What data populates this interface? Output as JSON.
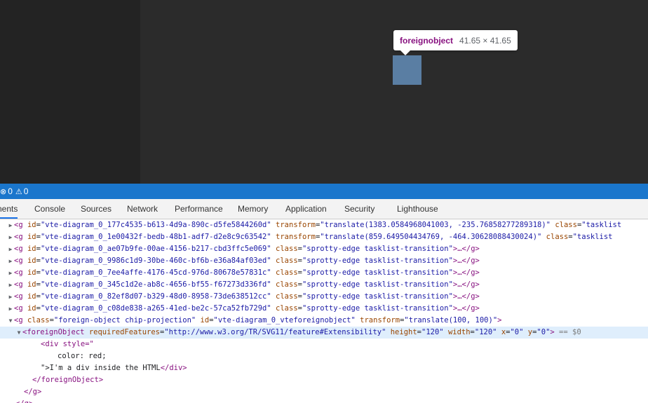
{
  "tooltip": {
    "tag": "foreignobject",
    "size": "41.65 × 41.65"
  },
  "statusbar": {
    "errors": "0",
    "warnings": "0"
  },
  "tabs": [
    {
      "label": "nents",
      "active": true
    },
    {
      "label": "Console"
    },
    {
      "label": "Sources"
    },
    {
      "label": "Network"
    },
    {
      "label": "Performance"
    },
    {
      "label": "Memory"
    },
    {
      "label": "Application"
    },
    {
      "label": "Security"
    },
    {
      "label": "Lighthouse"
    }
  ],
  "tree": {
    "rows": [
      {
        "caret": "▶",
        "open": "<g",
        "attrs": [
          [
            "id",
            "\"vte-diagram_0_177c4535-b613-4d9a-890c-d5fe5844260d\""
          ],
          [
            "transform",
            "\"translate(1383.0584968041003, -235.76858277289318)\""
          ],
          [
            "class",
            "\"tasklist"
          ]
        ],
        "close": ""
      },
      {
        "caret": "▶",
        "open": "<g",
        "attrs": [
          [
            "id",
            "\"vte-diagram_0_1e00432f-bedb-48b1-adf7-d2e8c9c63542\""
          ],
          [
            "transform",
            "\"translate(859.649504434769, -464.30628088430024)\""
          ],
          [
            "class",
            "\"tasklist"
          ]
        ],
        "close": ""
      },
      {
        "caret": "▶",
        "open": "<g",
        "attrs": [
          [
            "id",
            "\"vte-diagram_0_ae07b9fe-00ae-4156-b217-cbd3ffc5e069\""
          ],
          [
            "class",
            "\"sprotty-edge tasklist-transition\""
          ]
        ],
        "close": ">…</g>"
      },
      {
        "caret": "▶",
        "open": "<g",
        "attrs": [
          [
            "id",
            "\"vte-diagram_0_9986c1d9-30be-460c-bf6b-e36a84af03ed\""
          ],
          [
            "class",
            "\"sprotty-edge tasklist-transition\""
          ]
        ],
        "close": ">…</g>"
      },
      {
        "caret": "▶",
        "open": "<g",
        "attrs": [
          [
            "id",
            "\"vte-diagram_0_7ee4affe-4176-45cd-976d-80678e57831c\""
          ],
          [
            "class",
            "\"sprotty-edge tasklist-transition\""
          ]
        ],
        "close": ">…</g>"
      },
      {
        "caret": "▶",
        "open": "<g",
        "attrs": [
          [
            "id",
            "\"vte-diagram_0_345c1d2e-ab8c-4656-bf55-f67273d336fd\""
          ],
          [
            "class",
            "\"sprotty-edge tasklist-transition\""
          ]
        ],
        "close": ">…</g>"
      },
      {
        "caret": "▶",
        "open": "<g",
        "attrs": [
          [
            "id",
            "\"vte-diagram_0_82ef8d07-b329-48d0-8958-73de638512cc\""
          ],
          [
            "class",
            "\"sprotty-edge tasklist-transition\""
          ]
        ],
        "close": ">…</g>"
      },
      {
        "caret": "▶",
        "open": "<g",
        "attrs": [
          [
            "id",
            "\"vte-diagram_0_c08de838-a265-41ed-be2c-57ca52fb729d\""
          ],
          [
            "class",
            "\"sprotty-edge tasklist-transition\""
          ]
        ],
        "close": ">…</g>"
      },
      {
        "caret": "▼",
        "open": "<g",
        "attrs": [
          [
            "class",
            "\"foreign-object chip-projection\""
          ],
          [
            "id",
            "\"vte-diagram_0_vteforeignobject\""
          ],
          [
            "transform",
            "\"translate(100, 100)\""
          ]
        ],
        "close": ">"
      },
      {
        "caret": "▼",
        "open": "<foreignObject",
        "attrs": [
          [
            "requiredFeatures",
            "\"http://www.w3.org/TR/SVG11/feature#Extensibility\""
          ],
          [
            "height",
            "\"120\""
          ],
          [
            "width",
            "\"120\""
          ],
          [
            "x",
            "\"0\""
          ],
          [
            "y",
            "\"0\""
          ]
        ],
        "close": ">",
        "suffix": " == $0",
        "selected": true
      },
      {
        "tagline": "<div style=\""
      },
      {
        "plainline": "color: red;"
      },
      {
        "textline": "\">I'm a div inside the HTML",
        "closetag": "</div>"
      },
      {
        "tagline": "</foreignObject>"
      },
      {
        "tagline": "</g>"
      },
      {
        "tagline": "</g>"
      }
    ]
  }
}
